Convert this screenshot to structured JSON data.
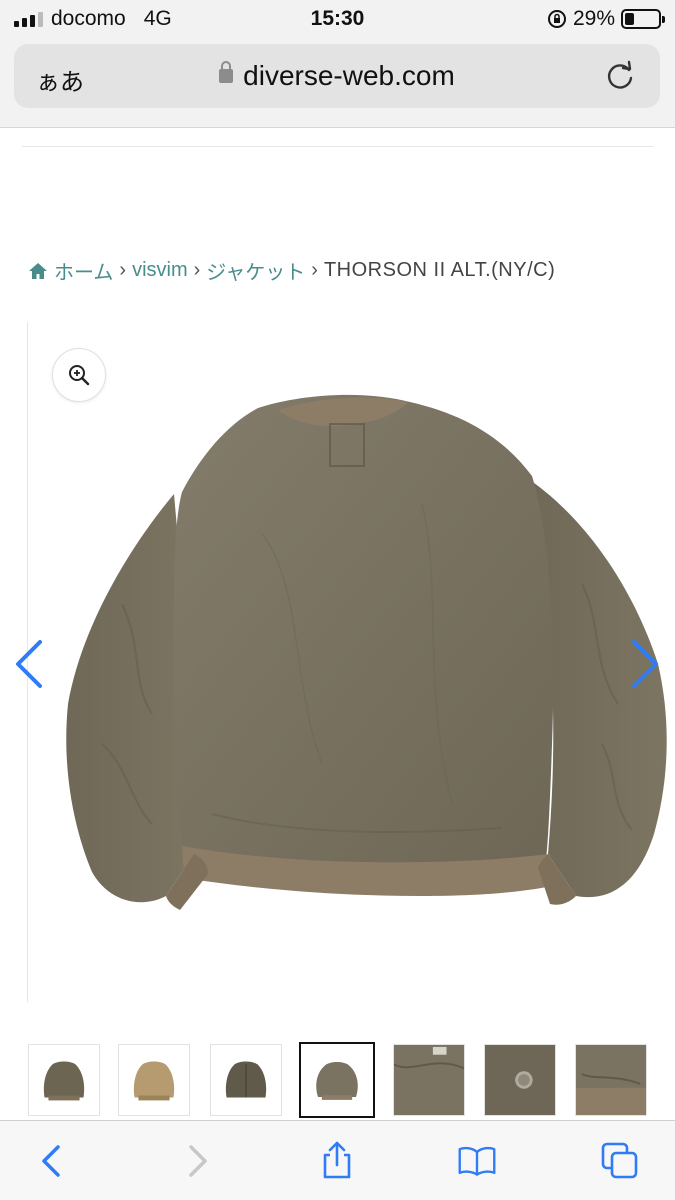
{
  "status_bar": {
    "carrier": "docomo",
    "network": "4G",
    "time": "15:30",
    "battery_percent": "29%",
    "battery_level": 0.29
  },
  "browser": {
    "text_size_button": "ぁあ",
    "url": "diverse-web.com"
  },
  "breadcrumb": {
    "items": [
      "ホーム",
      "visvim",
      "ジャケット"
    ],
    "separator": "›",
    "current": "THORSON II ALT.(NY/C)"
  },
  "gallery": {
    "thumbnail_count": 7,
    "active_thumbnail_index": 3
  },
  "colors": {
    "link": "#4a8c8c",
    "ios_blue": "#2f7cf6",
    "jacket_olive": "#7a7361",
    "jacket_rib": "#8d7c66",
    "jacket_tan": "#b59b6f"
  }
}
